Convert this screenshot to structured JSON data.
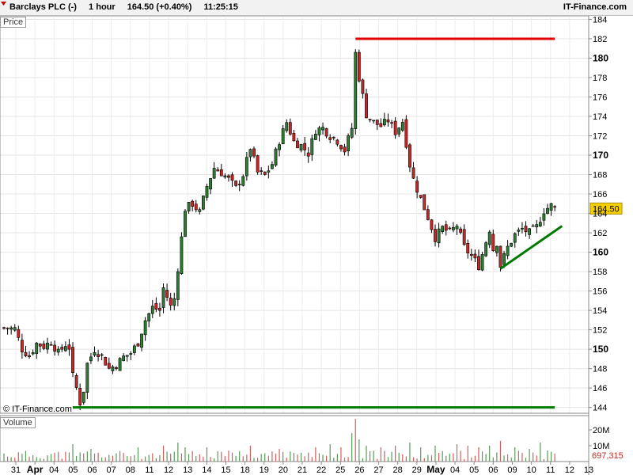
{
  "header": {
    "instrument": "Barclays PLC (-)",
    "interval": "1 hour",
    "quote": "164.50 (+0.40%)",
    "time": "11:25:15",
    "brand": "IT-Finance.com"
  },
  "panels": {
    "price_label": "Price",
    "volume_label": "Volume"
  },
  "copyright": "© IT-Finance.com",
  "colors": {
    "up": "#2e7d32",
    "down": "#c62828",
    "support": "#007a00",
    "resistance": "#e00000",
    "price_tag": "#f5d000"
  },
  "chart_data": [
    {
      "type": "candlestick",
      "title": "Barclays PLC (-)",
      "interval": "1 hour",
      "ylabel": "Price",
      "ylim": [
        143.4,
        184.2
      ],
      "y_ticks": [
        144,
        146,
        148,
        150,
        152,
        154,
        156,
        158,
        160,
        162,
        164,
        166,
        168,
        170,
        172,
        174,
        176,
        178,
        180,
        182,
        184
      ],
      "y_major_ticks": [
        150,
        160,
        170,
        180
      ],
      "last_price": "164.50",
      "x_ticks": [
        "31",
        "Apr",
        "04",
        "05",
        "06",
        "07",
        "08",
        "11",
        "12",
        "13",
        "14",
        "15",
        "18",
        "19",
        "20",
        "21",
        "22",
        "25",
        "26",
        "27",
        "28",
        "29",
        "May",
        "04",
        "05",
        "06",
        "09",
        "10",
        "11",
        "12",
        "13"
      ],
      "close_path": [
        [
          0,
          152.2
        ],
        [
          3,
          152.1
        ],
        [
          5,
          150.0
        ],
        [
          7,
          149.3
        ],
        [
          9,
          150.6
        ],
        [
          11,
          150.3
        ],
        [
          13,
          150.8
        ],
        [
          15,
          149.6
        ],
        [
          17,
          150.5
        ],
        [
          18,
          150.2
        ],
        [
          19,
          147.2
        ],
        [
          20,
          146.0
        ],
        [
          21,
          144.5
        ],
        [
          22,
          145.8
        ],
        [
          23,
          148.5
        ],
        [
          25,
          150.0
        ],
        [
          27,
          149.3
        ],
        [
          29,
          148.0
        ],
        [
          31,
          148.4
        ],
        [
          33,
          149.2
        ],
        [
          35,
          149.6
        ],
        [
          37,
          150.7
        ],
        [
          39,
          153.0
        ],
        [
          41,
          154.3
        ],
        [
          43,
          154.0
        ],
        [
          44,
          156.3
        ],
        [
          45,
          155.4
        ],
        [
          46,
          154.4
        ],
        [
          47,
          155.2
        ],
        [
          48,
          158.4
        ],
        [
          50,
          164.5
        ],
        [
          52,
          165.0
        ],
        [
          54,
          164.1
        ],
        [
          56,
          166.8
        ],
        [
          58,
          168.7
        ],
        [
          60,
          168.2
        ],
        [
          62,
          167.5
        ],
        [
          64,
          166.6
        ],
        [
          66,
          168.0
        ],
        [
          68,
          170.8
        ],
        [
          70,
          168.2
        ],
        [
          72,
          167.9
        ],
        [
          74,
          169.1
        ],
        [
          76,
          171.5
        ],
        [
          78,
          173.4
        ],
        [
          80,
          171.4
        ],
        [
          82,
          171.0
        ],
        [
          84,
          170.2
        ],
        [
          86,
          172.6
        ],
        [
          88,
          172.8
        ],
        [
          90,
          172.0
        ],
        [
          92,
          171.5
        ],
        [
          94,
          170.5
        ],
        [
          96,
          172.8
        ],
        [
          97,
          180.5
        ],
        [
          98,
          178.0
        ],
        [
          100,
          174.2
        ],
        [
          102,
          173.4
        ],
        [
          104,
          173.0
        ],
        [
          106,
          173.6
        ],
        [
          108,
          172.4
        ],
        [
          110,
          173.5
        ],
        [
          112,
          169.0
        ],
        [
          113,
          167.5
        ],
        [
          115,
          165.5
        ],
        [
          117,
          163.6
        ],
        [
          119,
          161.5
        ],
        [
          121,
          162.5
        ],
        [
          123,
          162.0
        ],
        [
          125,
          162.8
        ],
        [
          127,
          160.5
        ],
        [
          129,
          159.6
        ],
        [
          131,
          158.6
        ],
        [
          132,
          159.8
        ],
        [
          134,
          162.4
        ],
        [
          135,
          160.3
        ],
        [
          136,
          161.0
        ],
        [
          137,
          158.6
        ],
        [
          139,
          160.5
        ],
        [
          141,
          161.8
        ],
        [
          143,
          162.4
        ],
        [
          145,
          162.0
        ],
        [
          147,
          162.6
        ],
        [
          149,
          164.3
        ],
        [
          151,
          164.8
        ],
        [
          152,
          164.5
        ]
      ],
      "annotations": [
        {
          "type": "support",
          "name": "horizontal support",
          "x": [
            19,
            152
          ],
          "y": [
            144.0,
            144.0
          ]
        },
        {
          "type": "resistance",
          "name": "horizontal resistance",
          "x": [
            97,
            152
          ],
          "y": [
            182.0,
            182.0
          ]
        },
        {
          "type": "trendline",
          "name": "rising trendline",
          "x": [
            137,
            154
          ],
          "y": [
            158.3,
            162.7
          ]
        }
      ]
    },
    {
      "type": "bar",
      "title": "Volume",
      "y_ticks": [
        "10M",
        "20M"
      ],
      "ylim": [
        0,
        28
      ],
      "last_value": "697,315",
      "value_unit": "millions",
      "spikes": [
        [
          19,
          11
        ],
        [
          24,
          8
        ],
        [
          37,
          9
        ],
        [
          44,
          10
        ],
        [
          48,
          12
        ],
        [
          50,
          9
        ],
        [
          56,
          9
        ],
        [
          68,
          10
        ],
        [
          76,
          8
        ],
        [
          86,
          9
        ],
        [
          90,
          11
        ],
        [
          93,
          9
        ],
        [
          96,
          18
        ],
        [
          97,
          27
        ],
        [
          98,
          14
        ],
        [
          100,
          10
        ],
        [
          104,
          9
        ],
        [
          108,
          10
        ],
        [
          112,
          12
        ],
        [
          115,
          9
        ],
        [
          119,
          10
        ],
        [
          125,
          11
        ],
        [
          128,
          10
        ],
        [
          131,
          9
        ],
        [
          134,
          10
        ],
        [
          137,
          13
        ],
        [
          141,
          9
        ],
        [
          145,
          8
        ],
        [
          148,
          12
        ],
        [
          150,
          7
        ]
      ]
    }
  ]
}
